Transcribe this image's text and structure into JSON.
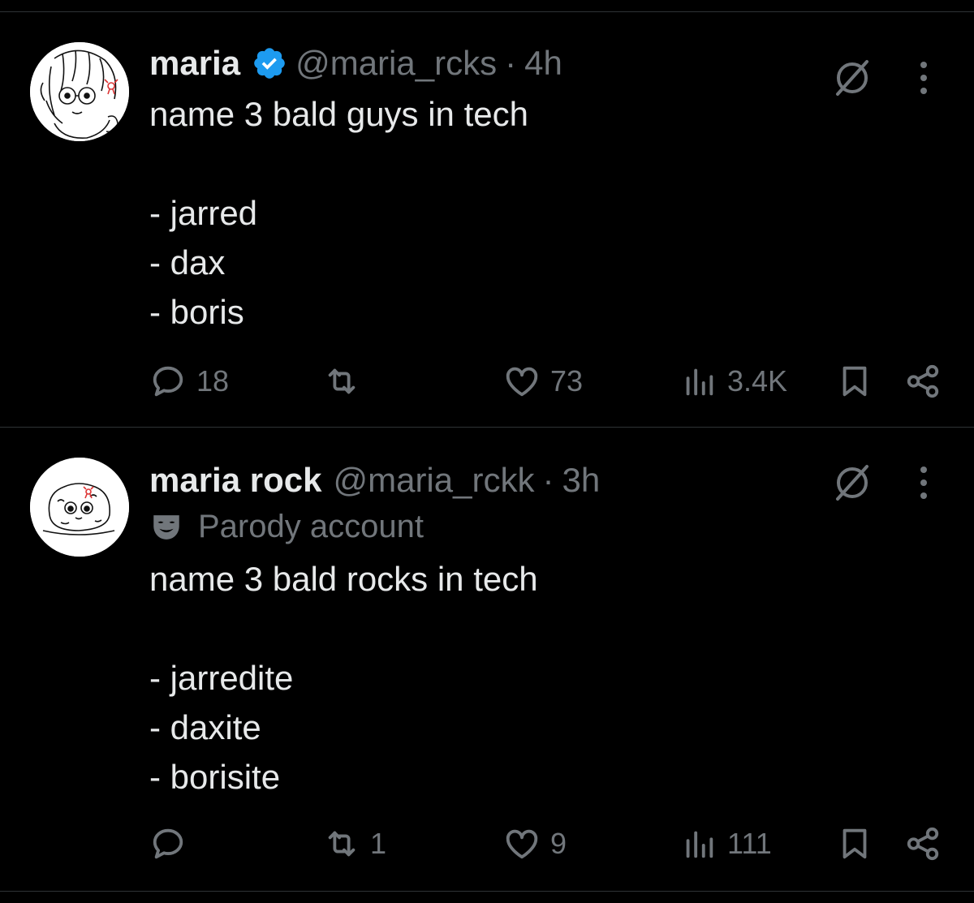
{
  "tweets": [
    {
      "display_name": "maria",
      "verified": true,
      "handle": "@maria_rcks",
      "separator": "·",
      "time": "4h",
      "parody_label": "",
      "text": "name 3 bald guys in tech\n\n- jarred\n- dax\n- boris",
      "replies": "18",
      "reposts": "",
      "likes": "73",
      "views": "3.4K"
    },
    {
      "display_name": "maria rock",
      "verified": false,
      "handle": "@maria_rckk",
      "separator": "·",
      "time": "3h",
      "parody_label": "Parody account",
      "text": "name 3 bald rocks in tech\n\n- jarredite\n- daxite\n- borisite",
      "replies": "",
      "reposts": "1",
      "likes": "9",
      "views": "111"
    }
  ],
  "colors": {
    "background": "#000000",
    "text": "#e7e9ea",
    "muted": "#71767b",
    "verified": "#1d9bf0",
    "divider": "#2f3336"
  },
  "icons": [
    "reply-icon",
    "repost-icon",
    "like-icon",
    "views-icon",
    "bookmark-icon",
    "share-icon",
    "grok-icon",
    "more-icon",
    "verified-badge-icon",
    "parody-mask-icon"
  ]
}
